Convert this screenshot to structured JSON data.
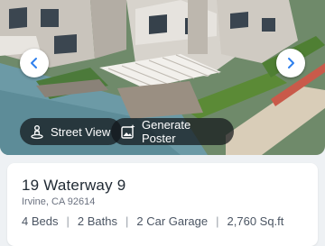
{
  "listing": {
    "address": "19 Waterway 9",
    "city": "Irvine, CA 92614",
    "specs": {
      "beds": "4 Beds",
      "baths": "2 Baths",
      "garage": "2 Car Garage",
      "size": "2,760 Sq.ft"
    },
    "separator": "|"
  },
  "photo_actions": {
    "street_view_label": "Street View",
    "generate_poster_label": "Generate Poster"
  },
  "icons": {
    "prev": "chevron-left-icon",
    "next": "chevron-right-icon",
    "street_view": "person-pin-icon",
    "generate_poster": "image-sparkle-icon"
  },
  "colors": {
    "accent": "#2f80ed",
    "chip_background": "#12161a",
    "card_background": "#ffffff",
    "page_background": "#eef1f4"
  }
}
